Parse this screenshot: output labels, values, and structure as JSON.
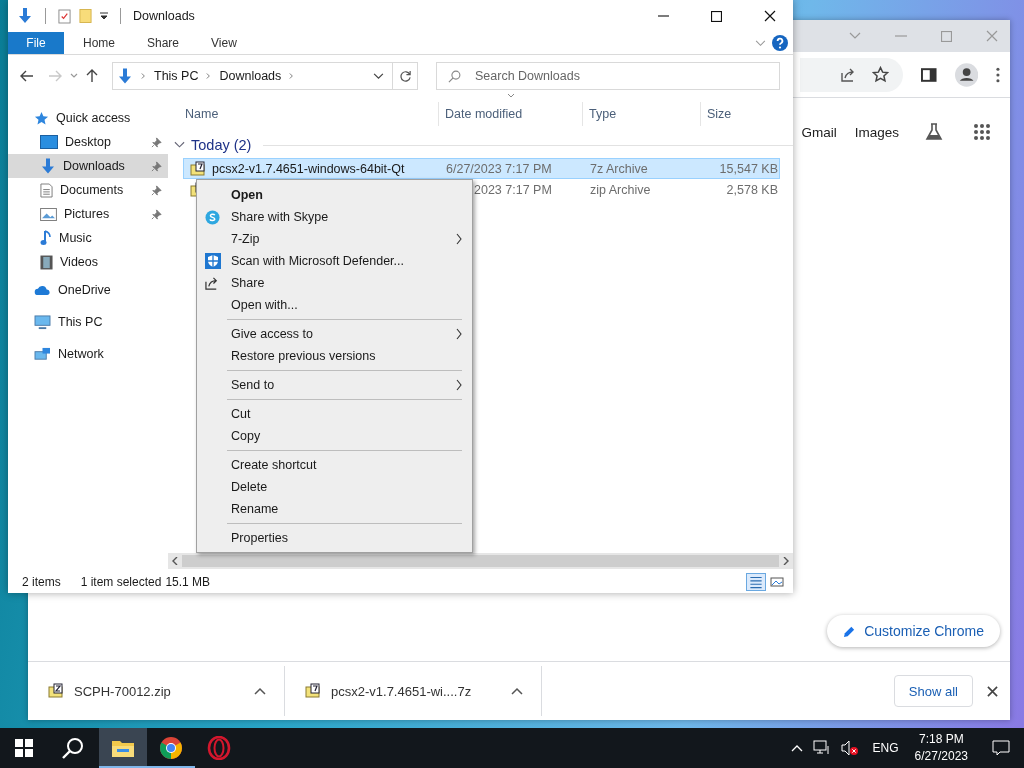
{
  "explorer": {
    "title": "Downloads",
    "ribbon_tabs": [
      {
        "label": "File",
        "selected": true
      },
      {
        "label": "Home",
        "selected": false
      },
      {
        "label": "Share",
        "selected": false
      },
      {
        "label": "View",
        "selected": false
      }
    ],
    "forward_disabled": true,
    "breadcrumb": [
      "This PC",
      "Downloads"
    ],
    "search": {
      "placeholder": "Search Downloads"
    },
    "nav": [
      {
        "label": "Quick access",
        "kind": "star",
        "selected": false,
        "children": [
          {
            "label": "Desktop",
            "kind": "desktop",
            "pinned": true,
            "selected": false
          },
          {
            "label": "Downloads",
            "kind": "downloads",
            "pinned": true,
            "selected": true
          },
          {
            "label": "Documents",
            "kind": "documents",
            "pinned": true,
            "selected": false
          },
          {
            "label": "Pictures",
            "kind": "pictures",
            "pinned": true,
            "selected": false
          },
          {
            "label": "Music",
            "kind": "music",
            "pinned": false,
            "selected": false
          },
          {
            "label": "Videos",
            "kind": "videos",
            "pinned": false,
            "selected": false
          }
        ]
      },
      {
        "label": "OneDrive",
        "kind": "cloud",
        "selected": false
      },
      {
        "label": "This PC",
        "kind": "computer",
        "selected": false
      },
      {
        "label": "Network",
        "kind": "network",
        "selected": false
      }
    ],
    "columns": [
      "Name",
      "Date modified",
      "Type",
      "Size"
    ],
    "group": {
      "label": "Today (2)",
      "expanded": true
    },
    "files": [
      {
        "name": "pcsx2-v1.7.4651-windows-64bit-Qt",
        "date": "6/27/2023 7:17 PM",
        "type": "7z Archive",
        "size": "15,547 KB",
        "kind": "sevenzip",
        "selected": true
      },
      {
        "date": "2023 7:17 PM",
        "type": "zip Archive",
        "size": "2,578 KB",
        "kind": "zip",
        "selected": false
      }
    ],
    "status": {
      "count": "2 items",
      "selection": "1 item selected",
      "size": "15.1 MB"
    }
  },
  "context_menu": {
    "groups": [
      [
        {
          "label": "Open",
          "kind": "default",
          "submenu": false
        },
        {
          "label": "Share with Skype",
          "kind": "skype",
          "submenu": false
        },
        {
          "label": "7-Zip",
          "kind": "plain",
          "submenu": true
        },
        {
          "label": "Scan with Microsoft Defender...",
          "kind": "defender",
          "submenu": false
        },
        {
          "label": "Share",
          "kind": "share",
          "submenu": false
        },
        {
          "label": "Open with...",
          "kind": "plain",
          "submenu": false
        }
      ],
      [
        {
          "label": "Give access to",
          "kind": "plain",
          "submenu": true
        },
        {
          "label": "Restore previous versions",
          "kind": "plain",
          "submenu": false
        }
      ],
      [
        {
          "label": "Send to",
          "kind": "plain",
          "submenu": true
        }
      ],
      [
        {
          "label": "Cut",
          "kind": "plain",
          "submenu": false
        },
        {
          "label": "Copy",
          "kind": "plain",
          "submenu": false
        }
      ],
      [
        {
          "label": "Create shortcut",
          "kind": "plain",
          "submenu": false
        },
        {
          "label": "Delete",
          "kind": "plain",
          "submenu": false
        },
        {
          "label": "Rename",
          "kind": "plain",
          "submenu": false
        }
      ],
      [
        {
          "label": "Properties",
          "kind": "plain",
          "submenu": false
        }
      ]
    ]
  },
  "chrome": {
    "links": [
      "Gmail",
      "Images"
    ],
    "customize_button": "Customize Chrome",
    "downloads": [
      {
        "name": "SCPH-70012.zip",
        "kind": "zip"
      },
      {
        "name": "pcsx2-v1.7.4651-wi....7z",
        "kind": "sevenzip"
      }
    ],
    "show_all": "Show all"
  },
  "taskbar": {
    "apps": [
      {
        "kind": "folder",
        "running": true,
        "selected": true
      },
      {
        "kind": "chrome",
        "running": true,
        "selected": false
      },
      {
        "kind": "opera",
        "running": false,
        "selected": false
      }
    ],
    "language": "ENG",
    "time": "7:18 PM",
    "date": "6/27/2023"
  }
}
